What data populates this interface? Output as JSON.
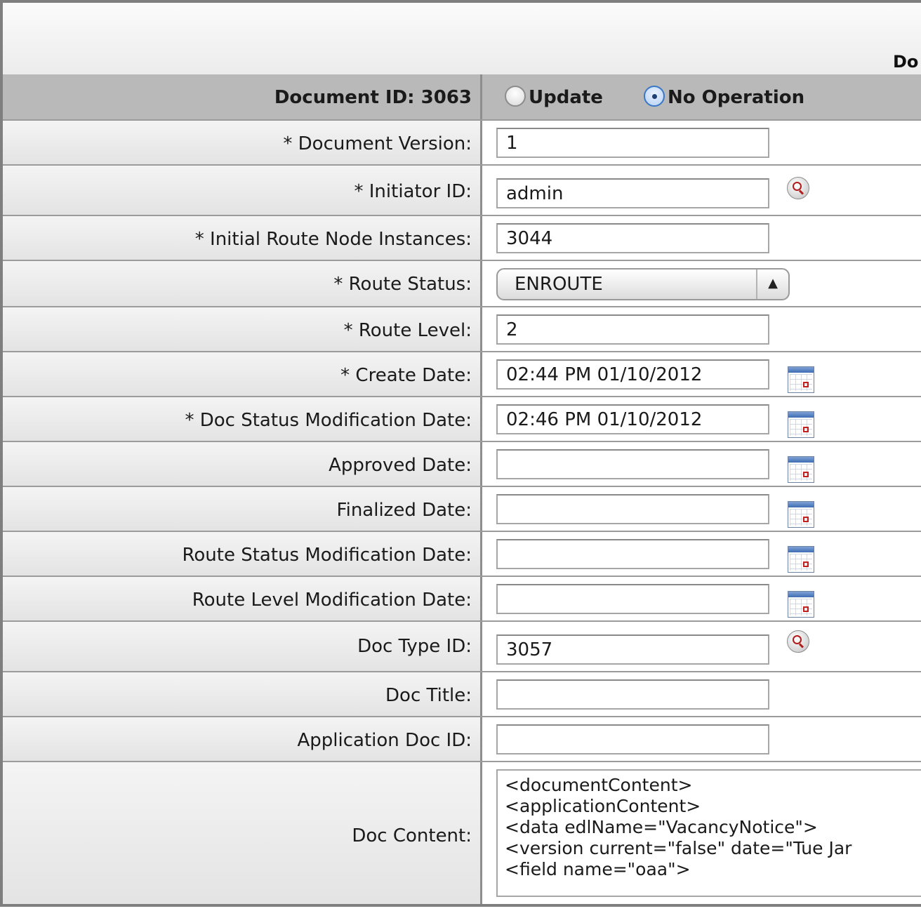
{
  "panel": {
    "title": "Do"
  },
  "header": {
    "document_id_label": "Document ID: 3063",
    "radio_update": "Update",
    "radio_no_operation": "No Operation",
    "selected": "No Operation"
  },
  "fields": {
    "document_version": {
      "label": "* Document Version:",
      "value": "1"
    },
    "initiator_id": {
      "label": "* Initiator ID:",
      "value": "admin"
    },
    "initial_route_node": {
      "label": "* Initial Route Node Instances:",
      "value": "3044"
    },
    "route_status": {
      "label": "* Route Status:",
      "value": "ENROUTE"
    },
    "route_level": {
      "label": "* Route Level:",
      "value": "2"
    },
    "create_date": {
      "label": "* Create Date:",
      "value": "02:44 PM 01/10/2012"
    },
    "doc_status_mod_date": {
      "label": "* Doc Status Modification Date:",
      "value": "02:46 PM 01/10/2012"
    },
    "approved_date": {
      "label": "Approved Date:",
      "value": ""
    },
    "finalized_date": {
      "label": "Finalized Date:",
      "value": ""
    },
    "route_status_mod_date": {
      "label": "Route Status Modification Date:",
      "value": ""
    },
    "route_level_mod_date": {
      "label": "Route Level Modification Date:",
      "value": ""
    },
    "doc_type_id": {
      "label": "Doc Type ID:",
      "value": "3057"
    },
    "doc_title": {
      "label": "Doc Title:",
      "value": ""
    },
    "application_doc_id": {
      "label": "Application Doc ID:",
      "value": ""
    },
    "doc_content": {
      "label": "Doc Content:",
      "value": "<documentContent>\n<applicationContent>\n<data edlName=\"VacancyNotice\">\n<version current=\"false\" date=\"Tue Jar\n<field name=\"oaa\">"
    }
  },
  "icons": {
    "lookup": "magnifier-icon",
    "calendar": "calendar-icon"
  }
}
